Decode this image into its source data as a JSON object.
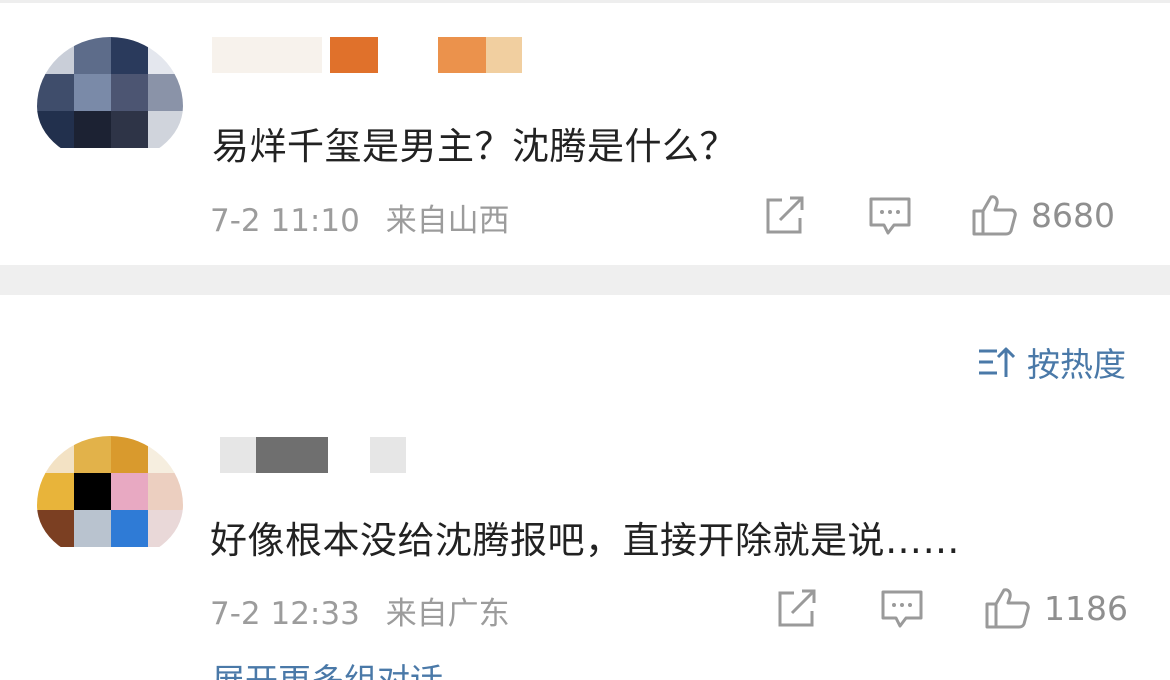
{
  "comments": [
    {
      "text": "易烊千玺是男主？沈腾是什么？",
      "time": "7-2 11:10",
      "location": "来自山西",
      "likes": "8680",
      "colors": {
        "avatar": [
          "#2a3a5c",
          "#7a8aa8",
          "#1c2233",
          "#4c5572"
        ],
        "name": [
          "#e0712b",
          "#eb924c",
          "#f1cfa0"
        ]
      }
    },
    {
      "text": "好像根本没给沈腾报吧，直接开除就是说……",
      "time": "7-2 12:33",
      "location": "来自广东",
      "likes": "1186",
      "colors": {
        "avatar": [
          "#d99a2d",
          "#e2b24a",
          "#000000",
          "#e8a9c2",
          "#b9c3cf",
          "#2f7bd6"
        ],
        "name": [
          "#6f6f6f",
          "#e6e6e6"
        ]
      }
    }
  ],
  "sort": {
    "label": "按热度"
  },
  "more_link": "展开更多组对话",
  "colors": {
    "link": "#4a79a8",
    "meta": "#9c9c9c",
    "text": "#222222",
    "divider": "#efefef"
  },
  "icons": [
    "share-icon",
    "comment-icon",
    "like-icon",
    "sort-icon"
  ]
}
